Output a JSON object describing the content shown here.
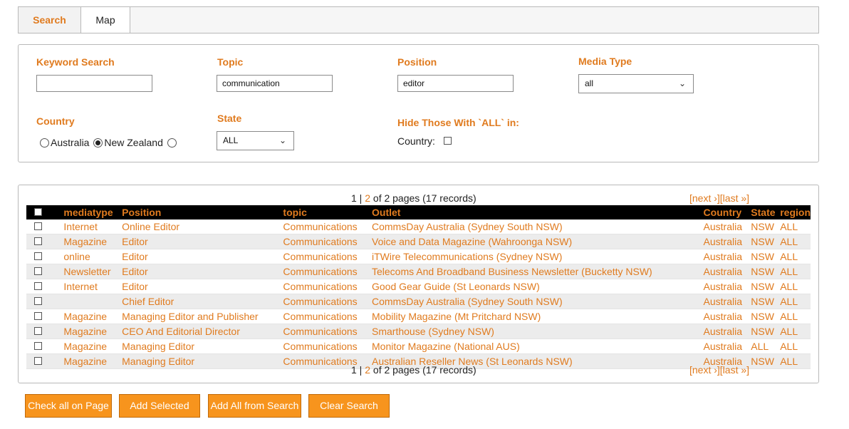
{
  "tabs": {
    "search": "Search",
    "map": "Map"
  },
  "filters": {
    "keyword": {
      "label": "Keyword Search",
      "value": ""
    },
    "topic": {
      "label": "Topic",
      "value": "communication"
    },
    "position": {
      "label": "Position",
      "value": "editor"
    },
    "media_type": {
      "label": "Media Type",
      "value": "all"
    },
    "country": {
      "label": "Country",
      "options": [
        "Australia",
        "New Zealand",
        ""
      ],
      "selected": "New Zealand"
    },
    "state": {
      "label": "State",
      "value": "ALL"
    },
    "hide": {
      "label": "Hide Those With `ALL` in:",
      "country_label": "Country:",
      "checked": false
    }
  },
  "pager": {
    "p1": "1",
    "sep": " | ",
    "p2": "2",
    "rest": " of 2 pages (17 records)",
    "next": "[next ›]",
    "last": "[last »]"
  },
  "columns": [
    "mediatype",
    "Position",
    "topic",
    "Outlet",
    "Country",
    "State",
    "region"
  ],
  "rows": [
    [
      "Internet",
      "Online Editor",
      "Communications",
      "CommsDay Australia (Sydney South NSW)",
      "Australia",
      "NSW",
      "ALL"
    ],
    [
      "Magazine",
      "Editor",
      "Communications",
      "Voice and Data Magazine (Wahroonga NSW)",
      "Australia",
      "NSW",
      "ALL"
    ],
    [
      "online",
      "Editor",
      "Communications",
      "iTWire Telecommunications (Sydney NSW)",
      "Australia",
      "NSW",
      "ALL"
    ],
    [
      "Newsletter",
      "Editor",
      "Communications",
      "Telecoms And Broadband Business Newsletter (Bucketty NSW)",
      "Australia",
      "NSW",
      "ALL"
    ],
    [
      "Internet",
      "Editor",
      "Communications",
      "Good Gear Guide (St Leonards NSW)",
      "Australia",
      "NSW",
      "ALL"
    ],
    [
      "",
      "Chief Editor",
      "Communications",
      "CommsDay Australia (Sydney South NSW)",
      "Australia",
      "NSW",
      "ALL"
    ],
    [
      "Magazine",
      "Managing Editor and Publisher",
      "Communications",
      "Mobility Magazine (Mt Pritchard NSW)",
      "Australia",
      "NSW",
      "ALL"
    ],
    [
      "Magazine",
      "CEO And Editorial Director",
      "Communications",
      "Smarthouse (Sydney NSW)",
      "Australia",
      "NSW",
      "ALL"
    ],
    [
      "Magazine",
      "Managing Editor",
      "Communications",
      "Monitor Magazine (National AUS)",
      "Australia",
      "ALL",
      "ALL"
    ],
    [
      "Magazine",
      "Managing Editor",
      "Communications",
      "Australian Reseller News (St Leonards NSW)",
      "Australia",
      "NSW",
      "ALL"
    ]
  ],
  "buttons": {
    "check_all": "Check all on Page",
    "add_selected": "Add Selected",
    "add_all": "Add All from Search",
    "clear": "Clear Search"
  },
  "colors": {
    "accent": "#e07b1f",
    "button": "#f7941d",
    "header_bg": "#000000",
    "row_alt": "#ececec"
  }
}
